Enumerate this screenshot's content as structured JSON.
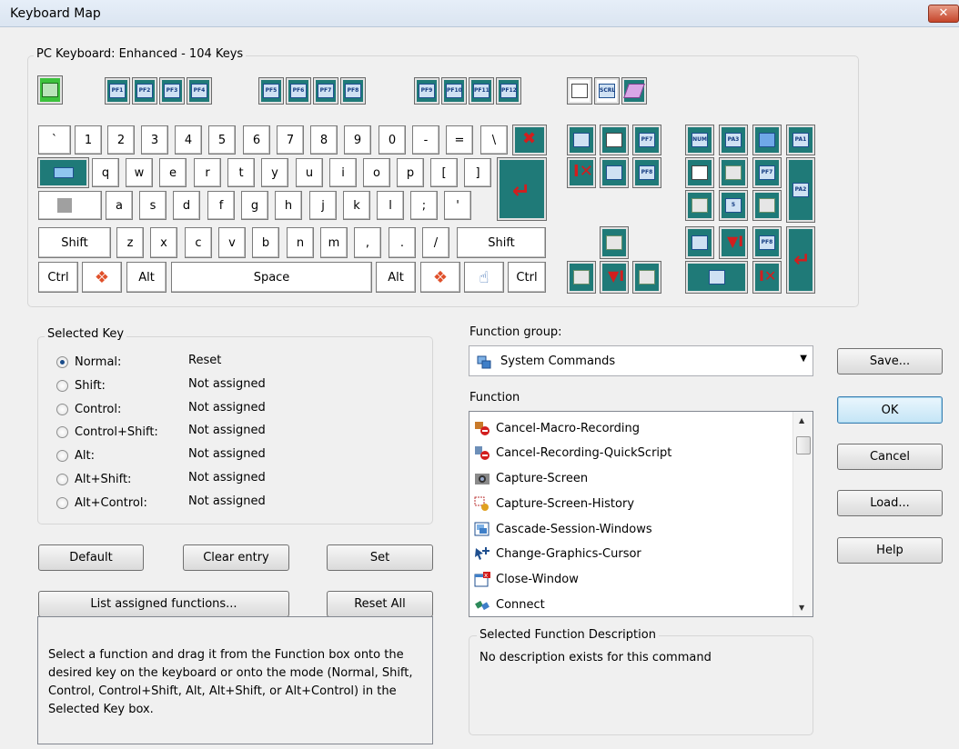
{
  "window": {
    "title": "Keyboard Map",
    "close_glyph": "✕"
  },
  "keyboard": {
    "title": "PC Keyboard:  Enhanced - 104 Keys",
    "pf_keys": [
      "PF1",
      "PF2",
      "PF3",
      "PF4",
      "PF5",
      "PF6",
      "PF7",
      "PF8",
      "PF9",
      "PF10",
      "PF11",
      "PF12"
    ],
    "top_right_icon": "SCRL",
    "row1": [
      "`",
      "1",
      "2",
      "3",
      "4",
      "5",
      "6",
      "7",
      "8",
      "9",
      "0",
      "-",
      "=",
      "\\"
    ],
    "row2": [
      "q",
      "w",
      "e",
      "r",
      "t",
      "y",
      "u",
      "i",
      "o",
      "p",
      "[",
      "]"
    ],
    "row3": [
      "a",
      "s",
      "d",
      "f",
      "g",
      "h",
      "j",
      "k",
      "l",
      ";",
      "'"
    ],
    "row4": [
      "z",
      "x",
      "c",
      "v",
      "b",
      "n",
      "m",
      ",",
      ".",
      "/"
    ],
    "shift_left": "Shift",
    "shift_right": "Shift",
    "ctrl_left": "Ctrl",
    "ctrl_right": "Ctrl",
    "alt_left": "Alt",
    "alt_right": "Alt",
    "space": "Space",
    "nav_labels": {
      "pf7": "PF7",
      "pf8": "PF8"
    },
    "pad_labels": {
      "num": "NUM",
      "pa3": "PA3",
      "pa1": "PA1",
      "pa2": "PA2",
      "pf7": "PF7",
      "five": "5",
      "pf8": "PF8"
    }
  },
  "selected_key": {
    "legend": "Selected Key",
    "modes": [
      {
        "label": "Normal:",
        "value": "Reset",
        "selected": true
      },
      {
        "label": "Shift:",
        "value": "Not assigned"
      },
      {
        "label": "Control:",
        "value": "Not assigned"
      },
      {
        "label": "Control+Shift:",
        "value": "Not assigned"
      },
      {
        "label": "Alt:",
        "value": "Not assigned"
      },
      {
        "label": "Alt+Shift:",
        "value": "Not assigned"
      },
      {
        "label": "Alt+Control:",
        "value": "Not assigned"
      }
    ]
  },
  "buttons": {
    "default": "Default",
    "clear": "Clear entry",
    "set": "Set",
    "list": "List assigned functions...",
    "reset_all": "Reset All",
    "save": "Save...",
    "ok": "OK",
    "cancel": "Cancel",
    "load": "Load...",
    "help": "Help"
  },
  "help_text": "Select a function and drag it from the Function box onto the desired key on the keyboard or onto the mode (Normal, Shift, Control, Control+Shift, Alt, Alt+Shift, or Alt+Control) in the Selected Key box.",
  "function_group": {
    "label": "Function group:",
    "value": "System Commands"
  },
  "function": {
    "label": "Function",
    "items": [
      "Cancel-Macro-Recording",
      "Cancel-Recording-QuickScript",
      "Capture-Screen",
      "Capture-Screen-History",
      "Cascade-Session-Windows",
      "Change-Graphics-Cursor",
      "Close-Window",
      "Connect"
    ]
  },
  "description": {
    "legend": "Selected Function Description",
    "text": "No description exists for this command"
  },
  "colors": {
    "key_teal": "#1f7a78",
    "accent_red": "#d21e1e"
  }
}
